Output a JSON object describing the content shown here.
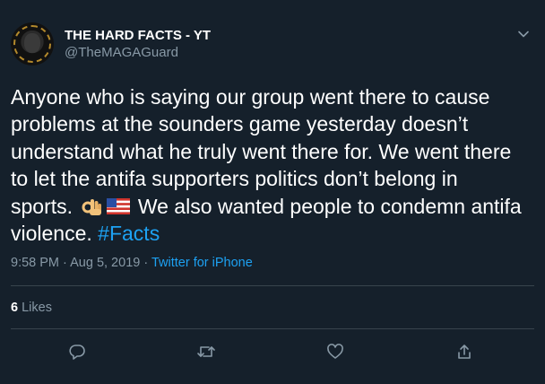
{
  "author": {
    "display_name": "THE HARD FACTS - YT",
    "handle": "@TheMAGAGuard"
  },
  "tweet": {
    "line1": "Anyone who is saying our group went there to cause",
    "line2": "problems at the sounders game yesterday doesn’t",
    "line3": "understand what he truly went there for. We went there",
    "line4": "to let the antifa supporters politics don’t belong in",
    "line5_before_emoji": "sports.",
    "line5_after_emoji": "We also wanted people to condemn antifa",
    "line6": "violence.",
    "hashtag": "#Facts",
    "emojis": [
      "ok-hand-emoji",
      "us-flag-emoji"
    ]
  },
  "meta": {
    "time": "9:58 PM",
    "date": "Aug 5, 2019",
    "separator": "·",
    "source": "Twitter for iPhone"
  },
  "stats": {
    "likes_count": "6",
    "likes_label": "Likes"
  },
  "colors": {
    "background": "#15202b",
    "text": "#ffffff",
    "secondary": "#8899a6",
    "link": "#1da1f2",
    "divider": "#38444d"
  },
  "actions": [
    "reply-icon",
    "retweet-icon",
    "like-icon",
    "share-icon"
  ]
}
